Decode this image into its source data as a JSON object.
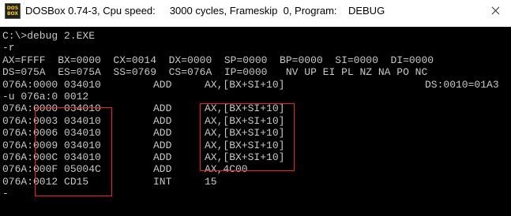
{
  "window": {
    "title": "DOSBox 0.74-3, Cpu speed:     3000 cycles, Frameskip  0, Program:    DEBUG",
    "icon_text_top": "DOS",
    "icon_text_bottom": "BOX",
    "icon_name": "dosbox-icon",
    "close_icon": "close-icon"
  },
  "terminal": {
    "lines": [
      {
        "cols": [
          "C:\\>debug 2.EXE"
        ]
      },
      {
        "cols": [
          "-r"
        ]
      },
      {
        "cols": [
          "AX=FFFF  BX=0000  CX=0014  DX=0000  SP=0000  BP=0000  SI=0000  DI=0000"
        ]
      },
      {
        "cols": [
          "DS=075A  ES=075A  SS=0769  CS=076A  IP=0000   NV UP EI PL NZ NA PO NC"
        ]
      },
      {
        "cols": [
          "076A:0000 034010",
          "ADD",
          "AX,[BX+SI+10]",
          "DS:0010=01A3"
        ]
      },
      {
        "cols": [
          "-u 076a:0 0012"
        ]
      },
      {
        "cols": [
          "076A:0000 034010",
          "ADD",
          "AX,[BX+SI+10]"
        ]
      },
      {
        "cols": [
          "076A:0003 034010",
          "ADD",
          "AX,[BX+SI+10]"
        ]
      },
      {
        "cols": [
          "076A:0006 034010",
          "ADD",
          "AX,[BX+SI+10]"
        ]
      },
      {
        "cols": [
          "076A:0009 034010",
          "ADD",
          "AX,[BX+SI+10]"
        ]
      },
      {
        "cols": [
          "076A:000C 034010",
          "ADD",
          "AX,[BX+SI+10]"
        ]
      },
      {
        "cols": [
          "076A:000F 05004C",
          "ADD",
          "AX,4C00"
        ]
      },
      {
        "cols": [
          "076A:0012 CD15",
          "INT",
          "15"
        ]
      },
      {
        "cols": [
          "-"
        ]
      }
    ]
  },
  "colors": {
    "terminal_bg": "#000000",
    "terminal_text": "#c8c8c8",
    "highlight": "#ff1a1a"
  }
}
